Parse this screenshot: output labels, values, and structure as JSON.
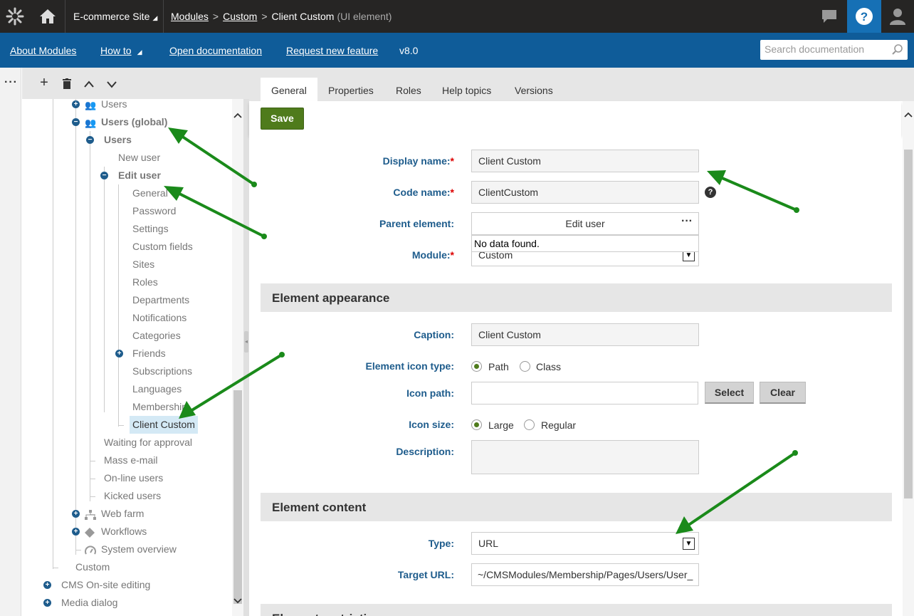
{
  "topbar": {
    "site": "E-commerce Site",
    "breadcrumb": {
      "modules": "Modules",
      "custom": "Custom",
      "current": "Client Custom",
      "current_type": "(UI element)"
    }
  },
  "bluebar": {
    "links": [
      "About Modules",
      "How to",
      "Open documentation",
      "Request new feature"
    ],
    "version": "v8.0",
    "search_placeholder": "Search documentation"
  },
  "tree": {
    "nodes": [
      {
        "label": "Users"
      },
      {
        "label": "Users (global)"
      },
      {
        "label": "Users"
      },
      {
        "label": "New user"
      },
      {
        "label": "Edit user"
      },
      {
        "label": "General"
      },
      {
        "label": "Password"
      },
      {
        "label": "Settings"
      },
      {
        "label": "Custom fields"
      },
      {
        "label": "Sites"
      },
      {
        "label": "Roles"
      },
      {
        "label": "Departments"
      },
      {
        "label": "Notifications"
      },
      {
        "label": "Categories"
      },
      {
        "label": "Friends"
      },
      {
        "label": "Subscriptions"
      },
      {
        "label": "Languages"
      },
      {
        "label": "Membership"
      },
      {
        "label": "Client Custom"
      },
      {
        "label": "Waiting for approval"
      },
      {
        "label": "Mass e-mail"
      },
      {
        "label": "On-line users"
      },
      {
        "label": "Kicked users"
      },
      {
        "label": "Web farm"
      },
      {
        "label": "Workflows"
      },
      {
        "label": "System overview"
      },
      {
        "label": "Custom"
      },
      {
        "label": "CMS On-site editing"
      },
      {
        "label": "Media dialog"
      }
    ]
  },
  "tabs": [
    "General",
    "Properties",
    "Roles",
    "Help topics",
    "Versions"
  ],
  "save_label": "Save",
  "form": {
    "display_name": {
      "label": "Display name:",
      "value": "Client Custom"
    },
    "code_name": {
      "label": "Code name:",
      "value": "ClientCustom"
    },
    "parent_element": {
      "label": "Parent element:",
      "value": "Edit user",
      "dropdown_text": "No data found."
    },
    "module": {
      "label": "Module:",
      "value": "Custom"
    },
    "appearance_title": "Element appearance",
    "caption": {
      "label": "Caption:",
      "value": "Client Custom"
    },
    "icon_type": {
      "label": "Element icon type:",
      "options": [
        "Path",
        "Class"
      ],
      "selected": "Path"
    },
    "icon_path": {
      "label": "Icon path:",
      "value": "",
      "select_label": "Select",
      "clear_label": "Clear"
    },
    "icon_size": {
      "label": "Icon size:",
      "options": [
        "Large",
        "Regular"
      ],
      "selected": "Large"
    },
    "description": {
      "label": "Description:",
      "value": ""
    },
    "content_title": "Element content",
    "type": {
      "label": "Type:",
      "value": "URL"
    },
    "target_url": {
      "label": "Target URL:",
      "value": "~/CMSModules/Membership/Pages/Users/User_"
    },
    "next_section_title": "Element restrictions"
  },
  "colors": {
    "topbar": "#262524",
    "bluebar": "#0f5c99",
    "accent": "#1670b5",
    "label": "#1e5c8c",
    "save": "#4f7b1c",
    "arrow": "#1a8a1a"
  }
}
